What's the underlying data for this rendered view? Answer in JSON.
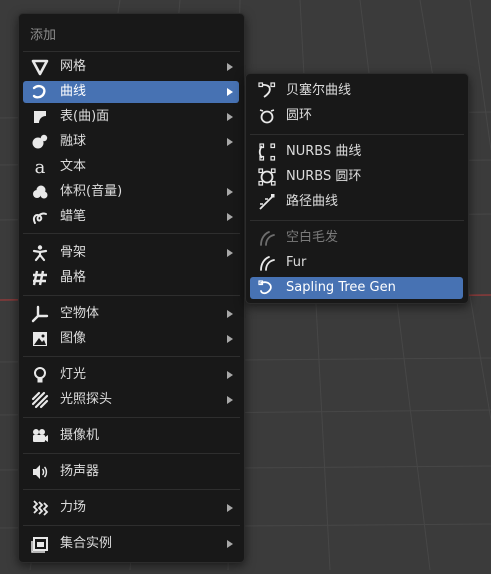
{
  "menu": {
    "title": "添加",
    "items": [
      {
        "label": "网格",
        "icon": "mesh-icon"
      },
      {
        "label": "曲线",
        "icon": "curve-icon"
      },
      {
        "label": "表(曲)面",
        "icon": "surface-icon"
      },
      {
        "label": "融球",
        "icon": "metaball-icon"
      },
      {
        "label": "文本",
        "icon": "text-icon"
      },
      {
        "label": "体积(音量)",
        "icon": "volume-icon"
      },
      {
        "label": "蜡笔",
        "icon": "grease-pencil-icon"
      },
      {
        "label": "骨架",
        "icon": "armature-icon"
      },
      {
        "label": "晶格",
        "icon": "lattice-icon"
      },
      {
        "label": "空物体",
        "icon": "empty-icon"
      },
      {
        "label": "图像",
        "icon": "image-icon"
      },
      {
        "label": "灯光",
        "icon": "light-icon"
      },
      {
        "label": "光照探头",
        "icon": "light-probe-icon"
      },
      {
        "label": "摄像机",
        "icon": "camera-icon"
      },
      {
        "label": "扬声器",
        "icon": "speaker-icon"
      },
      {
        "label": "力场",
        "icon": "force-field-icon"
      },
      {
        "label": "集合实例",
        "icon": "collection-instance-icon"
      }
    ]
  },
  "submenu": {
    "items": [
      {
        "label": "贝塞尔曲线",
        "icon": "bezier-curve-icon"
      },
      {
        "label": "圆环",
        "icon": "bezier-circle-icon"
      },
      {
        "label": "NURBS 曲线",
        "icon": "nurbs-curve-icon"
      },
      {
        "label": "NURBS 圆环",
        "icon": "nurbs-circle-icon"
      },
      {
        "label": "路径曲线",
        "icon": "path-curve-icon"
      },
      {
        "label": "空白毛发",
        "icon": "empty-hair-icon"
      },
      {
        "label": "Fur",
        "icon": "fur-icon"
      },
      {
        "label": "Sapling Tree Gen",
        "icon": "sapling-tree-icon"
      }
    ]
  },
  "colors": {
    "viewport": "#3b3b3b",
    "menu_bg": "#181818",
    "highlight": "#4772b3",
    "x_axis": "#8a3a3a"
  }
}
